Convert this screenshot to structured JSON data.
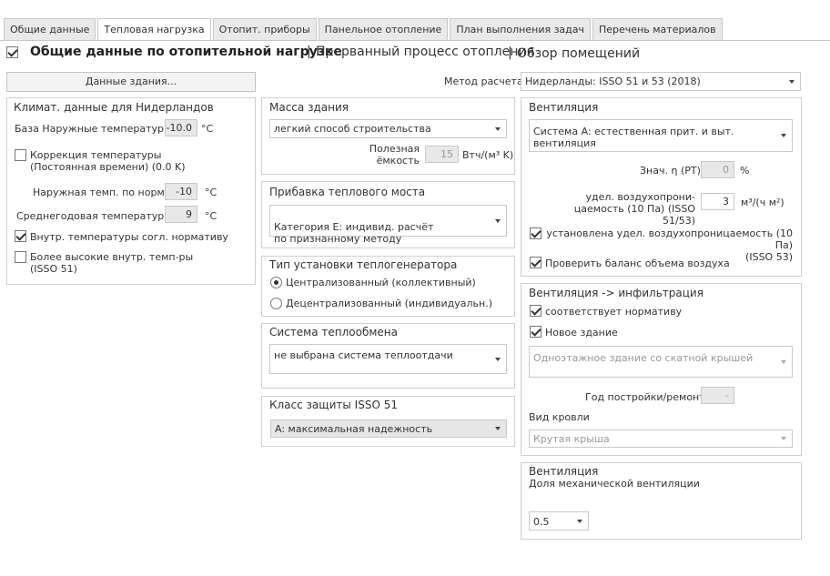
{
  "tabs": [
    "Общие данные",
    "Тепловая нагрузка",
    "Отопит. приборы",
    "Панельное отопление",
    "План выполнения задач",
    "Перечень материалов"
  ],
  "header": {
    "title": "Общие данные по отопительной нагрузке",
    "sep1": "|",
    "link1": "Прерванный процесс отопления",
    "sep2": "|",
    "link2": "Обзор помещений"
  },
  "building_button": "Данные здания...",
  "method": {
    "label": "Метод расчета",
    "value": "Нидерланды: ISSO 51 и 53 (2018)"
  },
  "climate": {
    "title": "Климат. данные для Нидерландов",
    "base_temp_label": "База Наружные температуры",
    "base_temp_value": "-10.0",
    "base_temp_unit": "°C",
    "correction_label": "Коррекция температуры\n(Постоянная времени) (0.0 K)",
    "outdoor_norm_label": "Наружная темп. по норме",
    "outdoor_norm_value": "-10",
    "outdoor_norm_unit": "°C",
    "annual_label": "Среднегодовая температура",
    "annual_value": "9",
    "annual_unit": "°C",
    "indoor_norm_label": "Внутр. температуры согл. нормативу",
    "high_indoor_label": "Более высокие внутр. темп-ры\n(ISSO 51)"
  },
  "mass": {
    "title": "Масса здания",
    "value": "легкий способ строительства",
    "capacity_label": "Полезная\nёмкость",
    "capacity_value": "15",
    "capacity_unit": "Втч/(м³ K)"
  },
  "bridge": {
    "title": "Прибавка теплового моста",
    "value": "Категория E: индивид. расчёт\nпо признанному методу"
  },
  "generator": {
    "title": "Тип установки теплогенератора",
    "option1": "Централизованный (коллективный)",
    "option2": "Децентрализованный (индивидуальн.)"
  },
  "exchange": {
    "title": "Система теплообмена",
    "value": "не выбрана система теплоотдачи"
  },
  "protection": {
    "title": "Класс защиты ISSO 51",
    "value": "A: максимальная надежность"
  },
  "ventilation": {
    "title": "Вентиляция",
    "system_value": "Система A: естественная прит. и выт. вентиляция",
    "eta_label": "Знач. η (РТ)",
    "eta_value": "0",
    "eta_unit": "%",
    "perm_label": "удел. воздухопрони-\nцаемость (10 Па) (ISSO 51/53)",
    "perm_value": "3",
    "perm_unit": "м³/(ч м²)",
    "perm_set_label": "установлена удел. воздухопроницаемость (10 Па)\n(ISSO 53)",
    "balance_label": "Проверить баланс объема воздуха"
  },
  "infiltration": {
    "title": "Вентиляция -> инфильтрация",
    "norm_label": "соответствует нормативу",
    "new_building_label": "Новое здание",
    "building_type": "Одноэтажное здание со скатной крышей",
    "year_label": "Год постройки/ремонта",
    "year_value": "-",
    "roof_label": "Вид кровли",
    "roof_value": "Крутая крыша"
  },
  "mech": {
    "title": "Вентиляция",
    "subtitle": "Доля механической вентиляции",
    "value": "0.5"
  }
}
